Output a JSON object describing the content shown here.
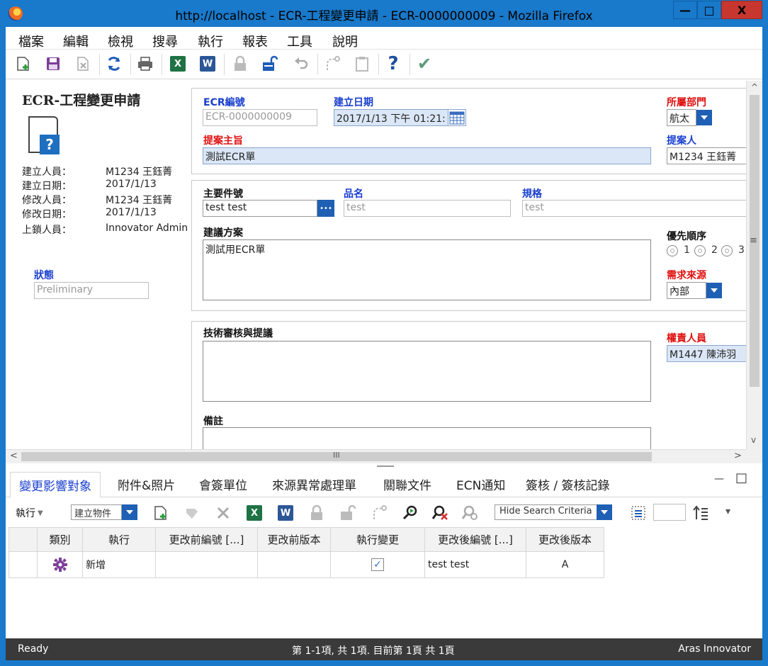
{
  "window": {
    "title": "http://localhost - ECR-工程變更申請 - ECR-0000000009 - Mozilla Firefox",
    "minimize_glyph": "—",
    "maximize_glyph": "□",
    "close_glyph": "X"
  },
  "menu": [
    "檔案",
    "編輯",
    "檢視",
    "搜尋",
    "執行",
    "報表",
    "工具",
    "說明"
  ],
  "toolbar": {
    "excel_label": "X",
    "word_label": "W",
    "help_label": "?",
    "check_label": "✔"
  },
  "left_panel": {
    "title": "ECR-工程變更申請",
    "doc_badge": "?",
    "meta": [
      {
        "label": "建立人員：",
        "value": "M1234 王鈺菁"
      },
      {
        "label": "建立日期：",
        "value": "2017/1/13"
      },
      {
        "label": "修改人員：",
        "value": "M1234 王鈺菁"
      },
      {
        "label": "修改日期：",
        "value": "2017/1/13"
      },
      {
        "label": "上鎖人員：",
        "value": "Innovator Admin"
      }
    ],
    "status_label": "狀態",
    "status_value": "Preliminary"
  },
  "form": {
    "ecr_no_label": "ECR編號",
    "ecr_no_value": "ECR-0000000009",
    "created_date_label": "建立日期",
    "created_date_value": "2017/1/13 下午 01:21:",
    "department_label": "所屬部門",
    "department_value": "航太",
    "subject_label": "提案主旨",
    "subject_value": "測試ECR單",
    "proposer_label": "提案人",
    "proposer_value": "M1234 王鈺菁",
    "main_part_label": "主要件號",
    "main_part_value": "test test",
    "main_part_btn": "•••",
    "part_name_label": "品名",
    "part_name_value": "test",
    "spec_label": "規格",
    "spec_value": "test",
    "proposal_label": "建議方案",
    "proposal_value": "測試用ECR單",
    "priority_label": "優先順序",
    "priority_options": [
      "1",
      "2",
      "3"
    ],
    "demand_source_label": "需求來源",
    "demand_source_value": "內部",
    "tech_review_label": "技術審核與提議",
    "tech_review_value": "",
    "responsible_label": "權責人員",
    "responsible_value": "M1447 陳沛羽",
    "remarks_label": "備註",
    "remarks_value": ""
  },
  "scroll": {
    "up": "^",
    "down": "v",
    "left": "<",
    "right": ">",
    "h_grip": "III",
    "v_grip": "≡"
  },
  "tabs": {
    "items": [
      "變更影響對象",
      "附件&照片",
      "會簽單位",
      "來源異常處理單",
      "關聯文件",
      "ECN通知",
      "簽核 / 簽核記錄"
    ],
    "min_glyph": "—",
    "max_glyph": "□"
  },
  "grid_toolbar": {
    "execute_label": "執行",
    "create_item_value": "建立物件",
    "search_mode_value": "Hide Search Criteria",
    "excel_label": "X",
    "word_label": "W",
    "more_label": "▾"
  },
  "grid": {
    "columns": [
      "類別",
      "執行",
      "更改前編號 [...]",
      "更改前版本",
      "執行變更",
      "更改後編號 [...]",
      "更改後版本"
    ],
    "rows": [
      {
        "category_icon": "gear-icon",
        "action": "新增",
        "before_no": "",
        "before_rev": "",
        "execute_change": true,
        "after_no": "test test",
        "after_rev": "A"
      }
    ]
  },
  "statusbar": {
    "left": "Ready",
    "center": "第 1-1項, 共 1項. 目前第 1頁 共 1頁",
    "right": "Aras Innovator"
  },
  "colors": {
    "frame": "#1979ca",
    "label_blue": "#1a3fcf",
    "label_red": "#e01010",
    "dropdown": "#1f5fb4",
    "statusbar": "#3a3a3a"
  }
}
